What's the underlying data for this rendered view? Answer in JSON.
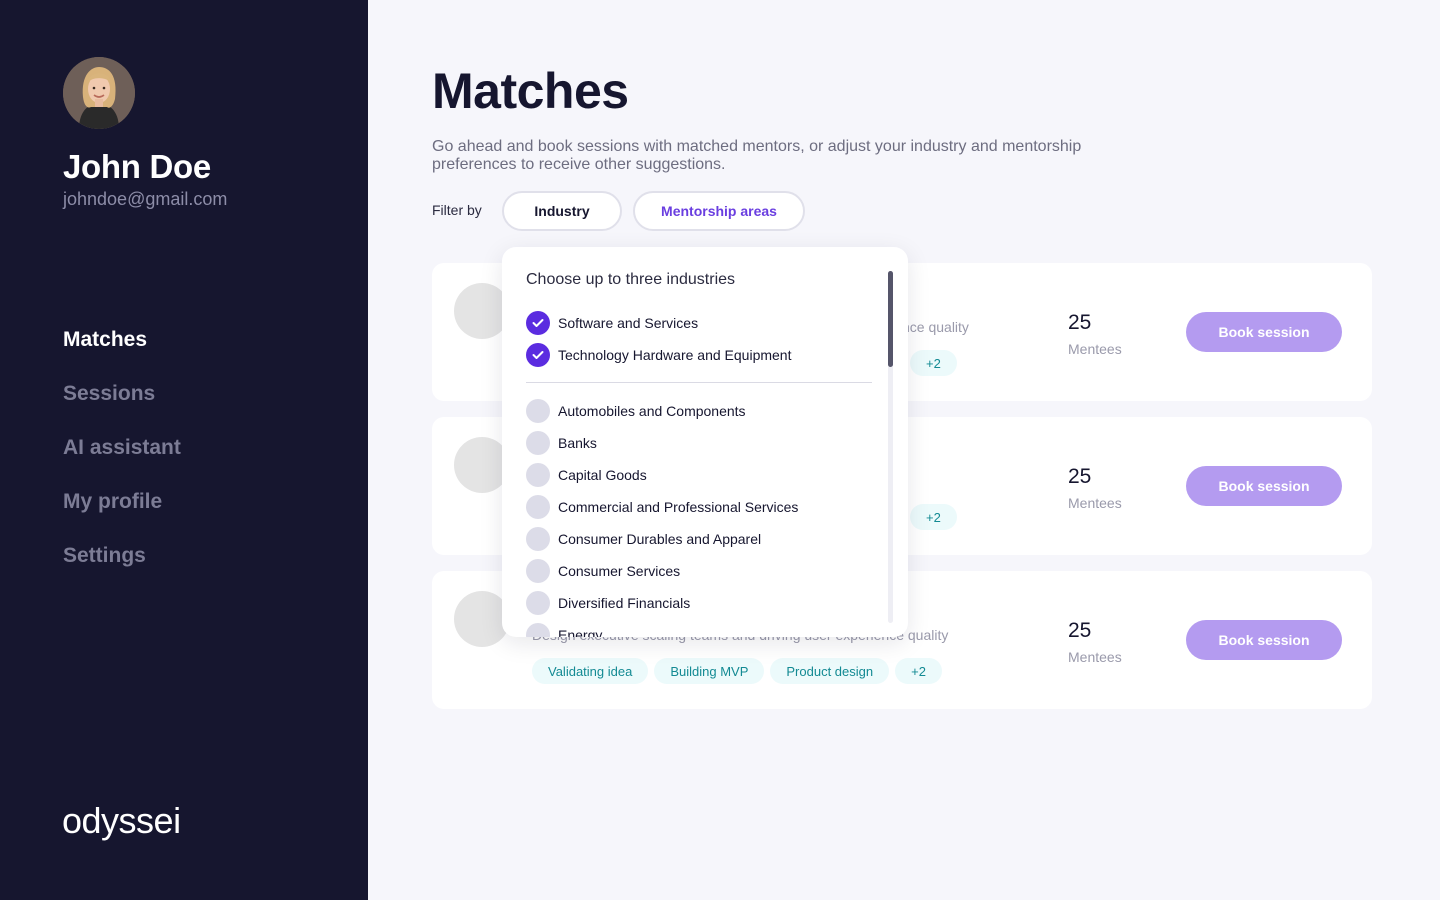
{
  "user": {
    "name": "John Doe",
    "email": "johndoe@gmail.com"
  },
  "nav": [
    {
      "label": "Matches",
      "active": true
    },
    {
      "label": "Sessions",
      "active": false
    },
    {
      "label": "AI assistant",
      "active": false
    },
    {
      "label": "My profile",
      "active": false
    },
    {
      "label": "Settings",
      "active": false
    }
  ],
  "logo": "odyssei",
  "page": {
    "title": "Matches",
    "description": "Go ahead and book sessions with matched mentors, or adjust your industry and mentorship preferences to receive other suggestions.",
    "filter_label": "Filter by",
    "filters": {
      "industry": "Industry",
      "areas": "Mentorship areas"
    }
  },
  "cards": [
    {
      "desc": "nce quality",
      "tags": [
        "+2"
      ],
      "count": "25",
      "count_label": "Mentees",
      "button": "Book session"
    },
    {
      "desc": "",
      "tags": [
        "+2"
      ],
      "count": "25",
      "count_label": "Mentees",
      "button": "Book session"
    },
    {
      "desc": "Design executive scaling teams and driving user experience quality",
      "tags": [
        "Validating idea",
        "Building MVP",
        "Product design",
        "+2"
      ],
      "count": "25",
      "count_label": "Mentees",
      "button": "Book session"
    }
  ],
  "dropdown": {
    "title": "Choose up to three industries",
    "selected": [
      "Software and Services",
      "Technology Hardware and Equipment"
    ],
    "options": [
      "Automobiles and Components",
      "Banks",
      "Capital Goods",
      "Commercial and Professional Services",
      "Consumer Durables and Apparel",
      "Consumer Services",
      "Diversified Financials",
      "Energy"
    ]
  },
  "colors": {
    "sidebar": "#16162f",
    "accent": "#5b2ce0",
    "button": "#b49bf0",
    "tag_text": "#138a93",
    "tag_bg": "#ecfafb"
  }
}
